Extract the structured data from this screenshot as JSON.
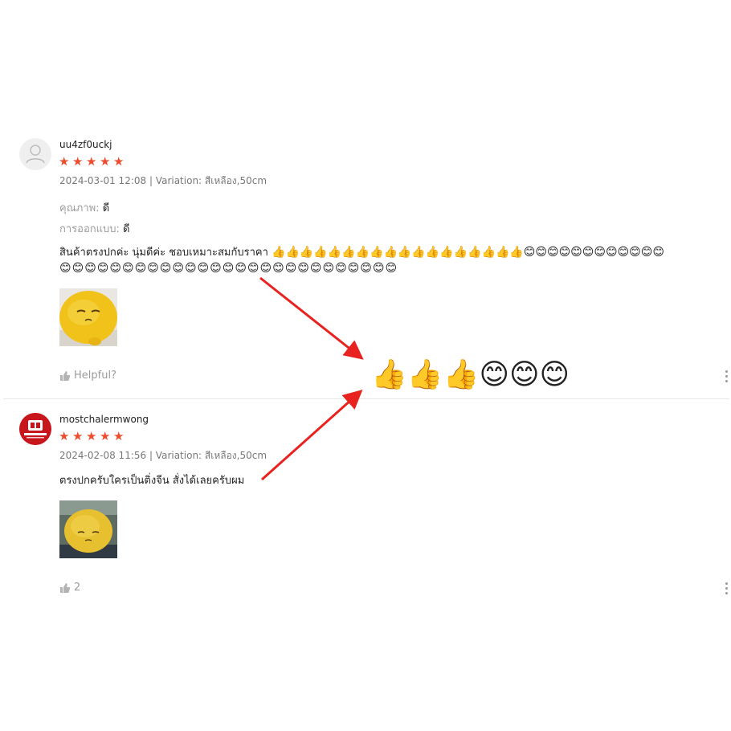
{
  "reviews": [
    {
      "username": "uu4zf0uckj",
      "rating": 5,
      "meta": "2024-03-01 12:08 | Variation: สีเหลือง,50cm",
      "attributes": [
        {
          "label": "คุณภาพ:",
          "value": "ดี"
        },
        {
          "label": "การออกแบบ:",
          "value": "ดี"
        }
      ],
      "comment_text": "สินค้าตรงปกค่ะ นุ่มดีค่ะ ชอบเหมาะสมกับราคา",
      "comment_emoji_line1": "👍👍👍👍👍👍👍👍👍👍👍👍👍👍👍👍👍👍😊😊😊😊😊😊😊😊😊😊😊😊",
      "comment_emoji_line2": "😊😊😊😊😊😊😊😊😊😊😊😊😊😊😊😊😊😊😊😊😊😊😊😊😊😊😊",
      "helpful_label": "Helpful?"
    },
    {
      "username": "mostchalermwong",
      "rating": 5,
      "meta": "2024-02-08 11:56 | Variation: สีเหลือง,50cm",
      "comment_text": "ตรงปกครับใครเป็นติ่งจีน สั่งได้เลยครับผม",
      "helpful_count": "2"
    }
  ],
  "callout_emojis": "👍👍👍😊😊😊",
  "colors": {
    "star": "#ee4d2d",
    "arrow": "#e8231f",
    "avatar_brand": "#c8161d"
  }
}
